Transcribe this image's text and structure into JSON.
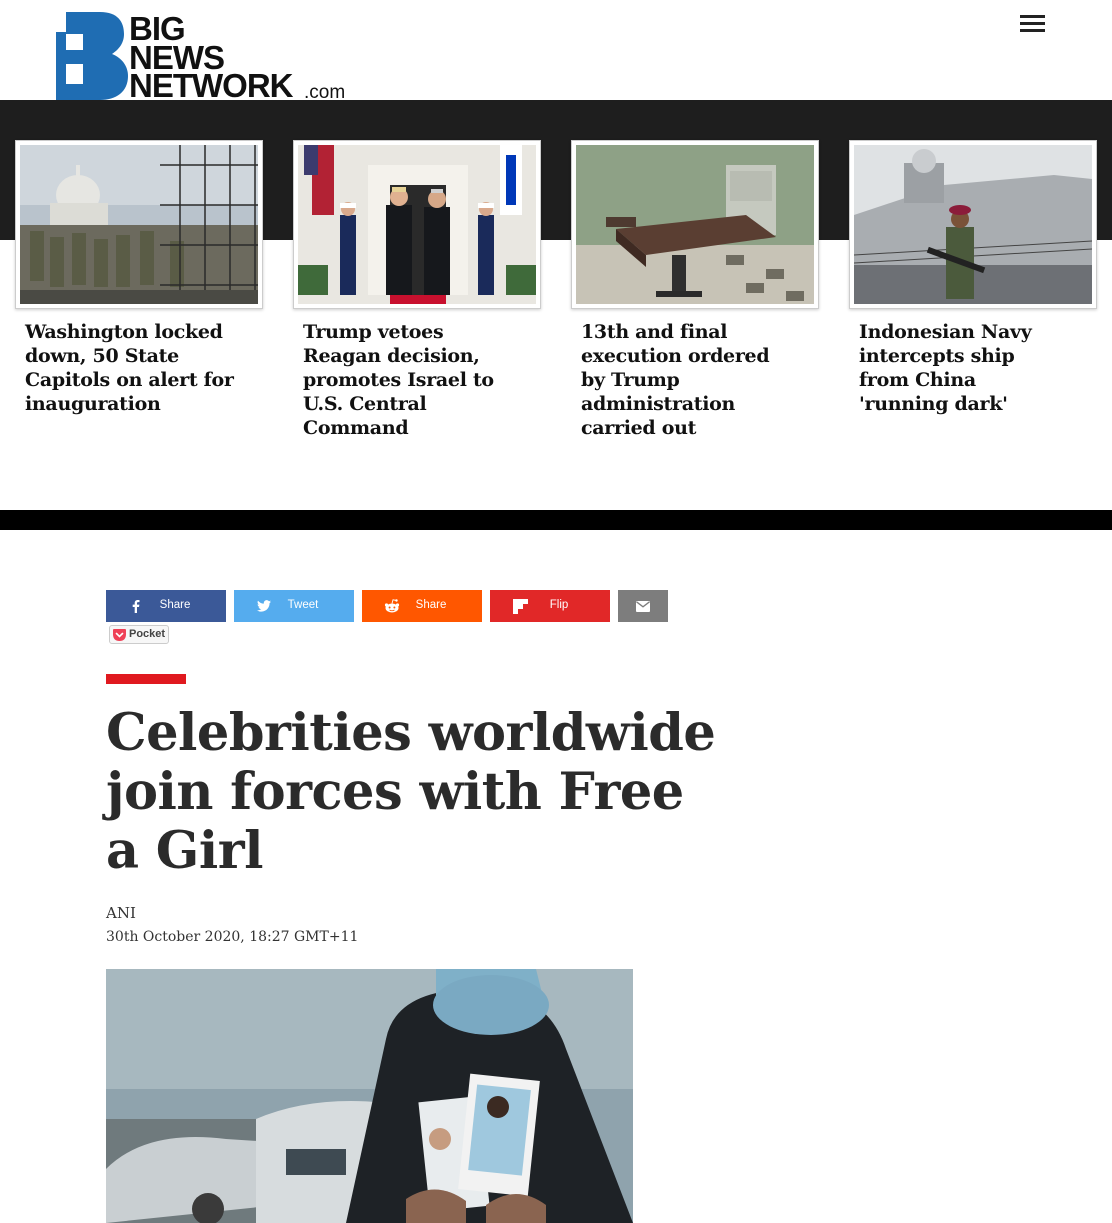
{
  "header": {
    "logo": {
      "line1": "BIG",
      "line2": "NEWS",
      "line3": "NETWORK",
      "suffix": ".com",
      "brand_color": "#1f6db3"
    },
    "menu_icon": "hamburger-menu-icon"
  },
  "top_stories": [
    {
      "title": "Washington locked down, 50 State Capitols on alert for inauguration"
    },
    {
      "title": "Trump vetoes Reagan decision, promotes Israel to U.S. Central Command"
    },
    {
      "title": "13th and final execution ordered by Trump administration carried out"
    },
    {
      "title": "Indonesian Navy intercepts ship from China 'running dark'"
    }
  ],
  "share": {
    "facebook": {
      "label": "Share",
      "icon": "facebook-icon",
      "color": "#3b5998"
    },
    "twitter": {
      "label": "Tweet",
      "icon": "twitter-icon",
      "color": "#55acee"
    },
    "reddit": {
      "label": "Share",
      "icon": "reddit-icon",
      "color": "#ff5700"
    },
    "flipboard": {
      "label": "Flip",
      "icon": "flipboard-icon",
      "color": "#e12828"
    },
    "email": {
      "icon": "email-icon",
      "color": "#7d7d7d"
    },
    "pocket": {
      "label": "Pocket",
      "icon": "pocket-icon",
      "color": "#ef4056"
    }
  },
  "article": {
    "accent_color": "#e0191f",
    "headline": "Celebrities worldwide join forces with Free a Girl",
    "author": "ANI",
    "date": "30th October 2020, 18:27 GMT+11"
  }
}
